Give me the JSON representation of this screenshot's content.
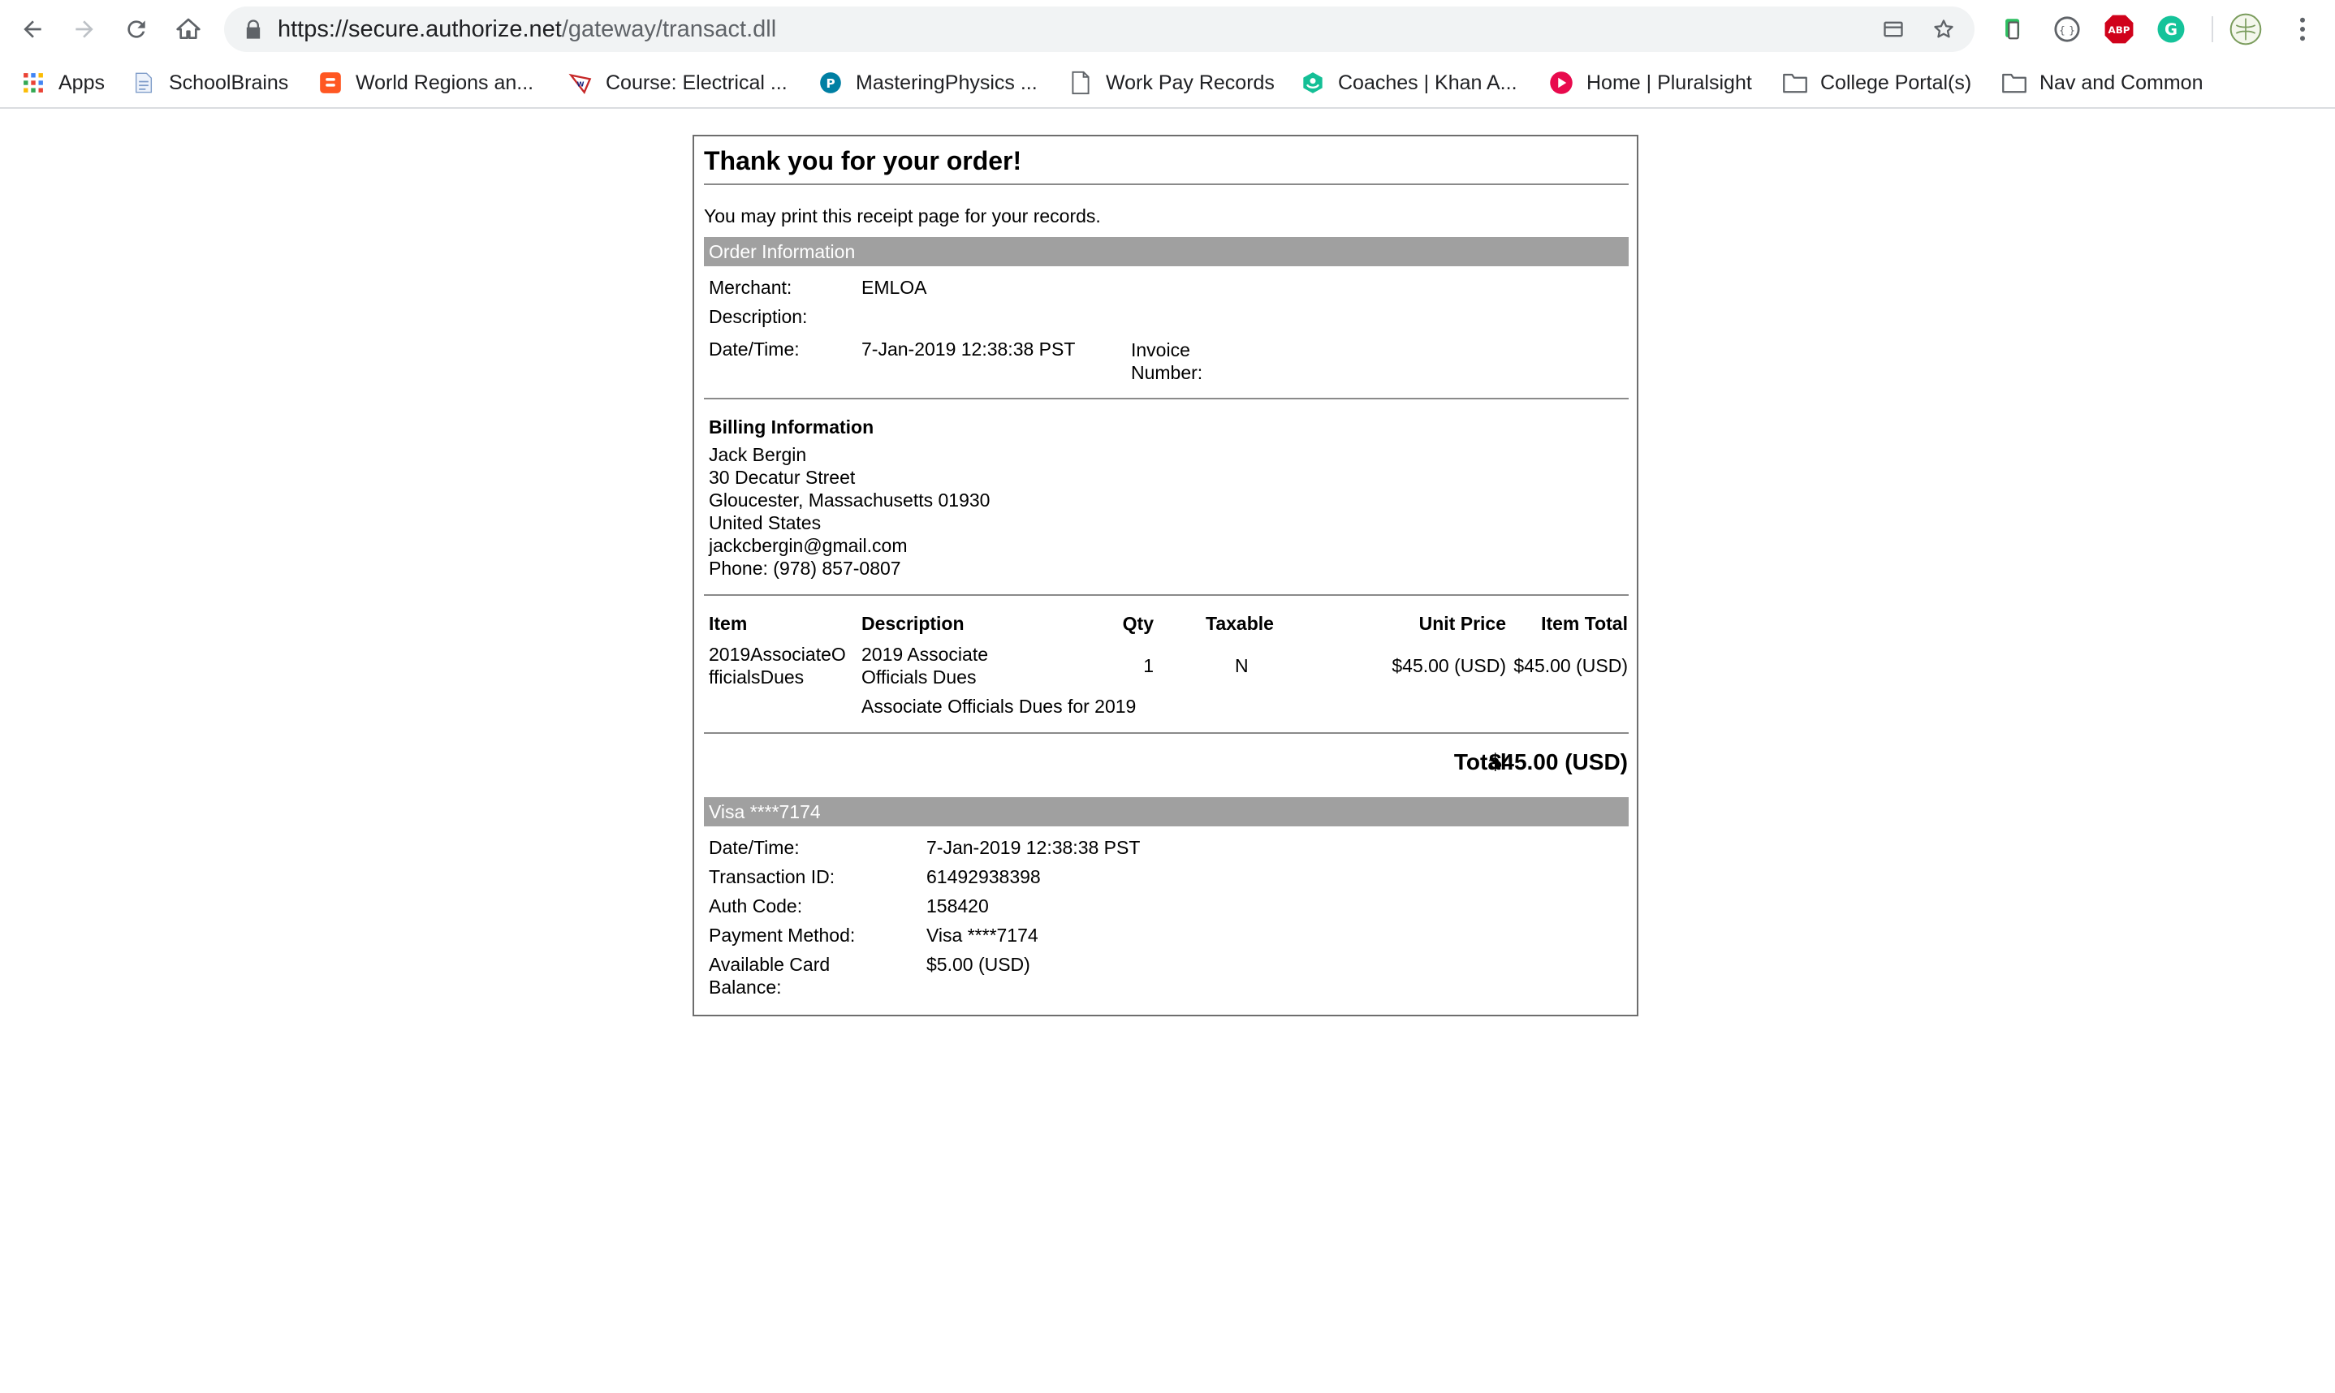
{
  "browser": {
    "url_host": "https://secure.authorize.net",
    "url_path": "/gateway/transact.dll",
    "bookmarks": [
      {
        "label": "Apps",
        "icon": "apps-grid-icon"
      },
      {
        "label": "SchoolBrains",
        "icon": "document-icon"
      },
      {
        "label": "World Regions an...",
        "icon": "blogger-icon"
      },
      {
        "label": "Course: Electrical ...",
        "icon": "course-icon"
      },
      {
        "label": "MasteringPhysics ...",
        "icon": "pearson-icon"
      },
      {
        "label": "Work Pay Records",
        "icon": "page-icon"
      },
      {
        "label": "Coaches | Khan A...",
        "icon": "khan-icon"
      },
      {
        "label": "Home | Pluralsight",
        "icon": "pluralsight-icon"
      },
      {
        "label": "College Portal(s)",
        "icon": "folder-icon"
      },
      {
        "label": "Nav and Common",
        "icon": "folder-icon"
      }
    ],
    "extensions": {
      "abp": "ABP",
      "grammarly": "G"
    }
  },
  "receipt": {
    "title": "Thank you for your order!",
    "intro": "You may print this receipt page for your records.",
    "order_info": {
      "header": "Order Information",
      "merchant_label": "Merchant:",
      "merchant_value": "EMLOA",
      "description_label": "Description:",
      "datetime_label": "Date/Time:",
      "datetime_value": "7-Jan-2019 12:38:38 PST",
      "invoice_label_1": "Invoice",
      "invoice_label_2": "Number:"
    },
    "billing": {
      "header": "Billing Information",
      "lines": [
        "Jack Bergin",
        "30 Decatur Street",
        "Gloucester, Massachusetts 01930",
        "United States",
        "jackcbergin@gmail.com",
        "Phone: (978) 857-0807"
      ]
    },
    "items_table": {
      "headers": {
        "item": "Item",
        "description": "Description",
        "qty": "Qty",
        "taxable": "Taxable",
        "unit_price": "Unit Price",
        "item_total": "Item Total"
      },
      "rows": [
        {
          "item_line1": "2019AssociateO",
          "item_line2": "fficialsDues",
          "desc_line1": "2019 Associate",
          "desc_line2": "Officials Dues",
          "desc_line3": "Associate Officials Dues for 2019",
          "qty": "1",
          "taxable": "N",
          "unit_price": "$45.00 (USD)",
          "item_total": "$45.00 (USD)"
        }
      ]
    },
    "total_label": "Total:",
    "total_value": "$45.00 (USD)",
    "payment": {
      "header": "Visa ****7174",
      "datetime_label": "Date/Time:",
      "datetime_value": "7-Jan-2019 12:38:38 PST",
      "txn_label": "Transaction ID:",
      "txn_value": "61492938398",
      "auth_label": "Auth Code:",
      "auth_value": "158420",
      "method_label": "Payment Method:",
      "method_value": "Visa ****7174",
      "balance_label_1": "Available Card",
      "balance_label_2": "Balance:",
      "balance_value": "$5.00 (USD)"
    }
  }
}
